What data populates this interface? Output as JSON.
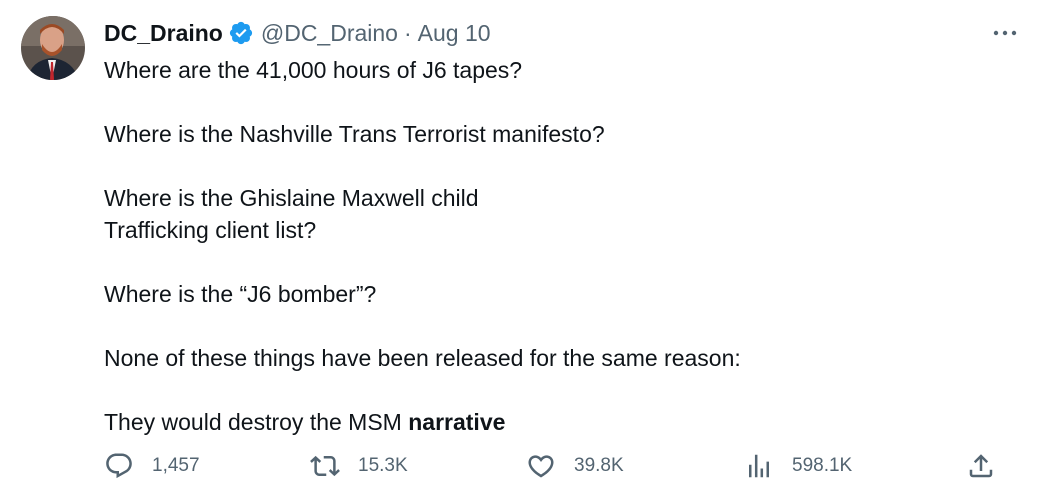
{
  "tweet": {
    "author": {
      "display_name": "DC_Draino",
      "handle": "@DC_Draino",
      "verified": true,
      "verified_icon": "verified-badge-icon",
      "avatar_icon": "avatar"
    },
    "separator": "·",
    "date": "Aug 10",
    "more_icon": "more-icon",
    "body": {
      "line1": "Where are the 41,000 hours of J6 tapes?",
      "line2": "Where is the Nashville Trans Terrorist manifesto?",
      "line3a": "Where is the Ghislaine Maxwell child",
      "line3b": "Trafficking client list?",
      "line4": "Where is the “J6 bomber”?",
      "line5": "None of these things have been released for the same reason:",
      "line6_prefix": "They would destroy the MSM ",
      "line6_bold": "narrative"
    },
    "actions": {
      "reply": {
        "icon": "reply-icon",
        "count": "1,457"
      },
      "retweet": {
        "icon": "retweet-icon",
        "count": "15.3K"
      },
      "like": {
        "icon": "heart-icon",
        "count": "39.8K"
      },
      "views": {
        "icon": "views-icon",
        "count": "598.1K"
      },
      "share": {
        "icon": "share-icon"
      }
    }
  },
  "colors": {
    "text": "#0f1419",
    "secondary": "#536471",
    "verified": "#1d9bf0"
  }
}
